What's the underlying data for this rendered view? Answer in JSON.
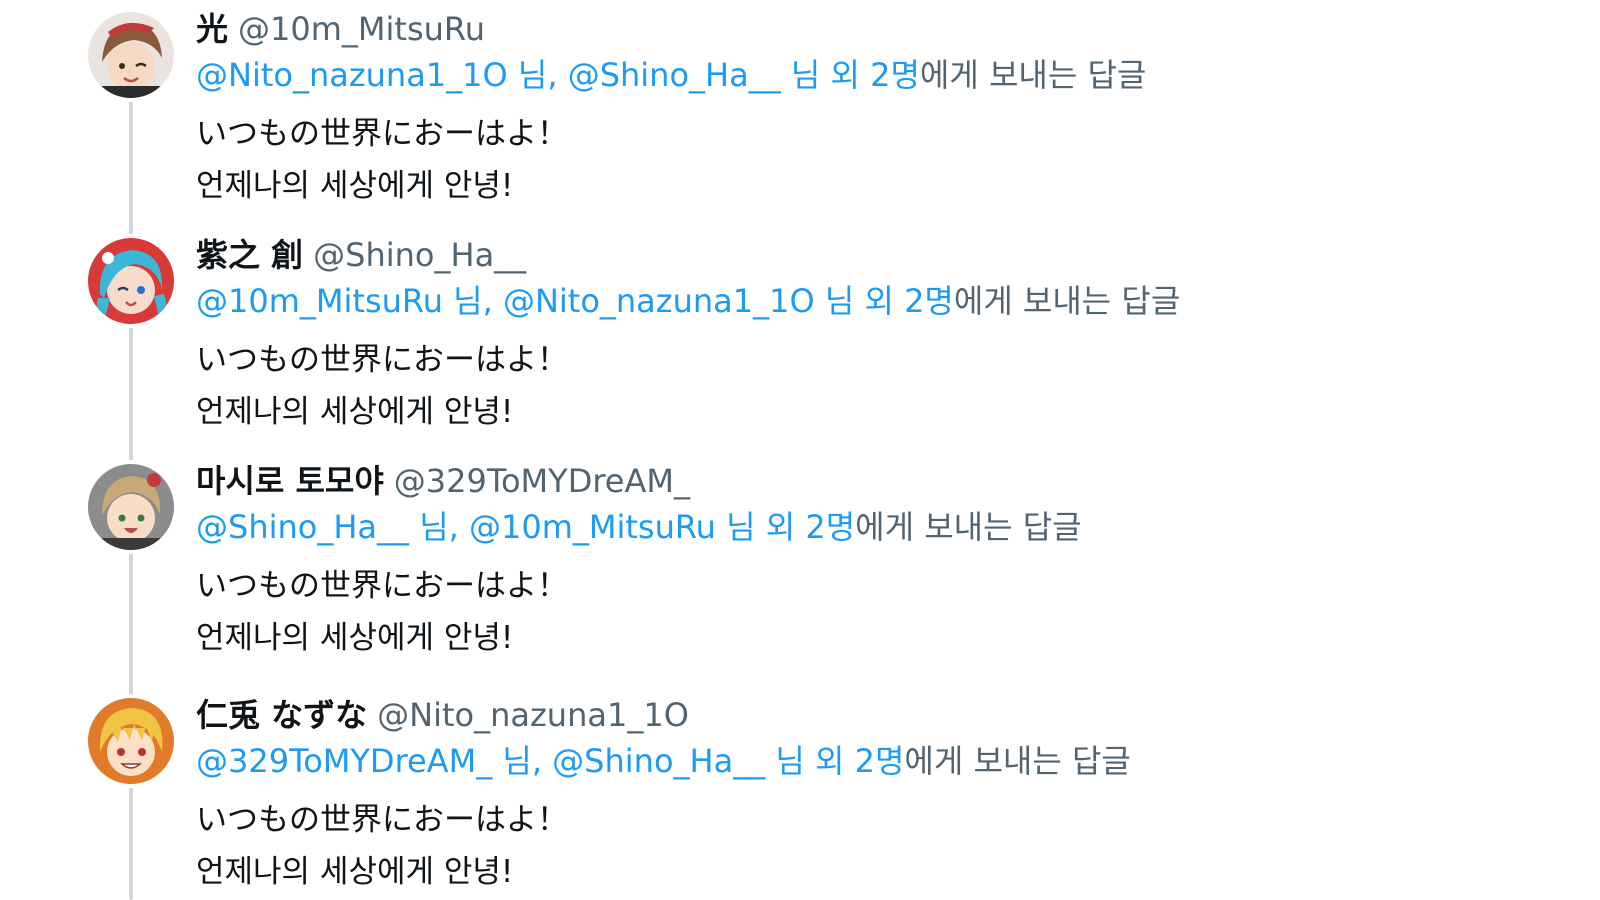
{
  "tweets": [
    {
      "display_name": "光",
      "handle": "@10m_MitsuRu",
      "reply": {
        "mention_1": "@Nito_nazuna1_1O",
        "sep_1": " 님, ",
        "mention_2": "@Shino_Ha__",
        "sep_2": " 님 외 ",
        "count": "2명",
        "suffix": "에게 보내는 답글"
      },
      "text_line_1": "いつもの世界におーはよ！",
      "text_line_2": "언제나의 세상에게 안녕!",
      "avatar_icon": "avatar-mitsuru-icon",
      "avatar_colors": {
        "hair": "#8a5a3a",
        "bg": "#e9e4df",
        "accent": "#c23b3b"
      }
    },
    {
      "display_name": "紫之 創",
      "handle": "@Shino_Ha__",
      "reply": {
        "mention_1": "@10m_MitsuRu",
        "sep_1": " 님, ",
        "mention_2": "@Nito_nazuna1_1O",
        "sep_2": " 님 외 ",
        "count": "2명",
        "suffix": "에게 보내는 답글"
      },
      "text_line_1": "いつもの世界におーはよ！",
      "text_line_2": "언제나의 세상에게 안녕!",
      "avatar_icon": "avatar-hajime-icon",
      "avatar_colors": {
        "hair": "#3fb6d8",
        "bg": "#d83a3a",
        "accent": "#2a6fd1"
      }
    },
    {
      "display_name": "마시로 토모야",
      "handle": "@329ToMYDreAM_",
      "reply": {
        "mention_1": "@Shino_Ha__",
        "sep_1": " 님, ",
        "mention_2": "@10m_MitsuRu",
        "sep_2": " 님 외 ",
        "count": "2명",
        "suffix": "에게 보내는 답글"
      },
      "text_line_1": "いつもの世界におーはよ！",
      "text_line_2": "언제나의 세상에게 안녕!",
      "avatar_icon": "avatar-tomoya-icon",
      "avatar_colors": {
        "hair": "#c9a878",
        "bg": "#8c8c8c",
        "accent": "#3a3a3a"
      }
    },
    {
      "display_name": "仁兎 なずな",
      "handle": "@Nito_nazuna1_1O",
      "reply": {
        "mention_1": "@329ToMYDreAM_",
        "sep_1": " 님, ",
        "mention_2": "@Shino_Ha__",
        "sep_2": " 님 외 ",
        "count": "2명",
        "suffix": "에게 보내는 답글"
      },
      "text_line_1": "いつもの世界におーはよ！",
      "text_line_2": "언제나의 세상에게 안녕!",
      "avatar_icon": "avatar-nazuna-icon",
      "avatar_colors": {
        "hair": "#f2c445",
        "bg": "#e07b2a",
        "accent": "#b8342c"
      }
    }
  ]
}
